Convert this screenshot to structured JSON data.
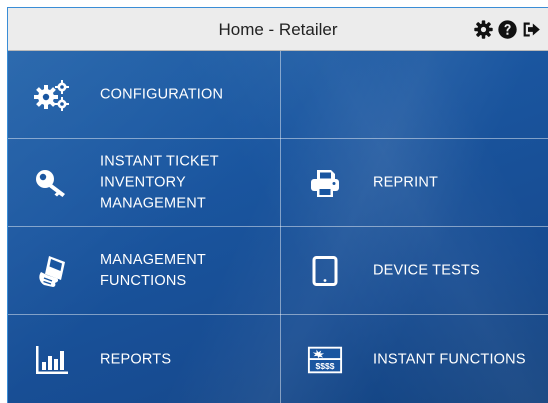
{
  "header": {
    "title": "Home - Retailer",
    "icons": [
      "gear-icon",
      "help-icon",
      "logout-icon"
    ]
  },
  "tiles": [
    {
      "id": "configuration",
      "icon": "gears-icon",
      "lines": [
        "CONFIGURATION"
      ]
    },
    {
      "id": "empty",
      "icon": "",
      "lines": []
    },
    {
      "id": "instant-ticket-inventory",
      "icon": "key-icon",
      "lines": [
        "INSTANT TICKET",
        "INVENTORY",
        "MANAGEMENT"
      ]
    },
    {
      "id": "reprint",
      "icon": "printer-icon",
      "lines": [
        "REPRINT"
      ]
    },
    {
      "id": "management-functions",
      "icon": "hand-terminal-icon",
      "lines": [
        "MANAGEMENT",
        "FUNCTIONS"
      ]
    },
    {
      "id": "device-tests",
      "icon": "tablet-icon",
      "lines": [
        "DEVICE TESTS"
      ]
    },
    {
      "id": "reports",
      "icon": "bar-chart-icon",
      "lines": [
        "REPORTS"
      ]
    },
    {
      "id": "instant-functions",
      "icon": "ticket-icon",
      "lines": [
        "INSTANT FUNCTIONS"
      ]
    }
  ],
  "instant_ticket_text": "$$$$",
  "colors": {
    "tile_bg": "#1a56a0",
    "header_bg": "#ececec",
    "text": "#ffffff"
  }
}
